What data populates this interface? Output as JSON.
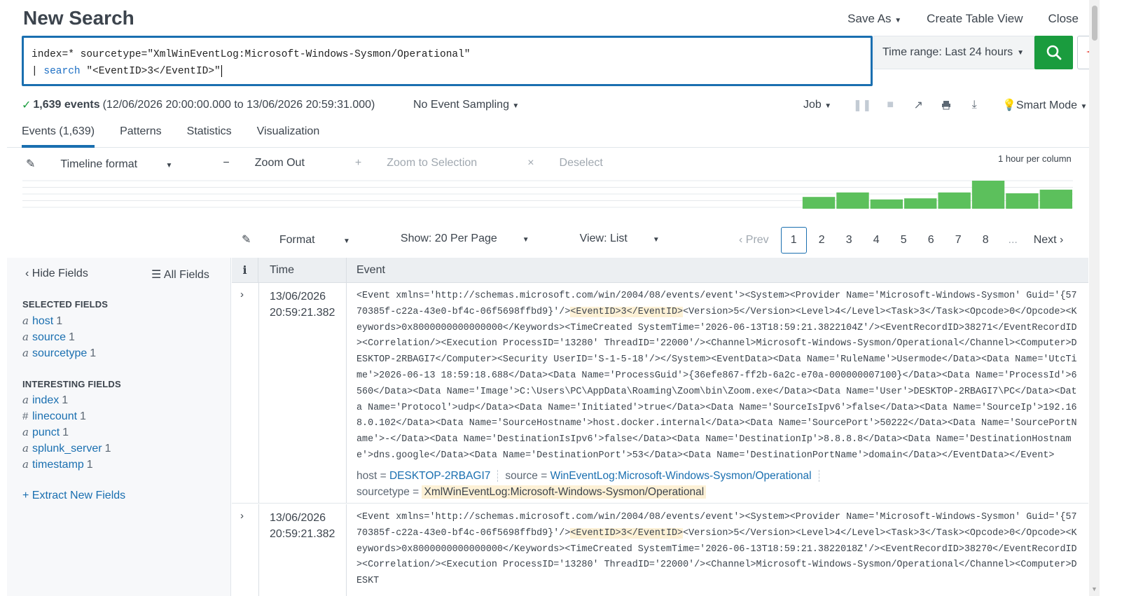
{
  "header": {
    "title": "New Search",
    "actions": [
      "Save As",
      "Create Table View",
      "Close"
    ]
  },
  "search": {
    "line1": "index=* sourcetype=\"XmlWinEventLog:Microsoft-Windows-Sysmon/Operational\"",
    "line2_pipe": "| ",
    "line2_kw": "search",
    "line2_rest": " \"<EventID>3</EventID>\"",
    "time_range": "Time range: Last 24 hours"
  },
  "status": {
    "count": "1,639 events",
    "range": "(12/06/2026 20:00:00.000 to 13/06/2026 20:59:31.000)",
    "sampling": "No Event Sampling",
    "job": "Job",
    "mode": "Smart Mode"
  },
  "tabs": [
    "Events (1,639)",
    "Patterns",
    "Statistics",
    "Visualization"
  ],
  "timeline": {
    "format": "Timeline format",
    "zoom_out": "Zoom Out",
    "zoom_sel": "Zoom to Selection",
    "deselect": "Deselect",
    "per_column": "1 hour per column",
    "bars": [
      0,
      0,
      0,
      0,
      0,
      0,
      0,
      0,
      0,
      0,
      0,
      0,
      0,
      0,
      0,
      0,
      0,
      0,
      0,
      0,
      0,
      0,
      0,
      0.42,
      0.58,
      0.33,
      0.37,
      0.58,
      1.0,
      0.55,
      0.68
    ],
    "bar_color": "#5cc05c"
  },
  "format_row": {
    "format": "Format",
    "show": "Show: 20 Per Page",
    "view": "View: List"
  },
  "pager": {
    "prev": "Prev",
    "pages": [
      "1",
      "2",
      "3",
      "4",
      "5",
      "6",
      "7",
      "8"
    ],
    "ellipsis": "...",
    "next": "Next"
  },
  "sidebar": {
    "hide": "Hide Fields",
    "all": "All Fields",
    "selected_title": "SELECTED FIELDS",
    "selected": [
      {
        "type": "a",
        "name": "host",
        "count": "1"
      },
      {
        "type": "a",
        "name": "source",
        "count": "1"
      },
      {
        "type": "a",
        "name": "sourcetype",
        "count": "1"
      }
    ],
    "interesting_title": "INTERESTING FIELDS",
    "interesting": [
      {
        "type": "a",
        "name": "index",
        "count": "1"
      },
      {
        "type": "#",
        "name": "linecount",
        "count": "1"
      },
      {
        "type": "a",
        "name": "punct",
        "count": "1"
      },
      {
        "type": "a",
        "name": "splunk_server",
        "count": "1"
      },
      {
        "type": "a",
        "name": "timestamp",
        "count": "1"
      }
    ],
    "extract": "+ Extract New Fields"
  },
  "table": {
    "col_i": "i",
    "col_time": "Time",
    "col_event": "Event"
  },
  "events": [
    {
      "date": "13/06/2026",
      "time": "20:59:21.382",
      "pre": "<Event xmlns='http://schemas.microsoft.com/win/2004/08/events/event'><System><Provider Name='Microsoft-Windows-Sysmon' Guid='{5770385f-c22a-43e0-bf4c-06f5698ffbd9}'/>",
      "hit": "<EventID>3</EventID>",
      "post": "<Version>5</Version><Level>4</Level><Task>3</Task><Opcode>0</Opcode><Keywords>0x8000000000000000</Keywords><TimeCreated SystemTime='2026-06-13T18:59:21.3822104Z'/><EventRecordID>38271</EventRecordID><Correlation/><Execution ProcessID='13280' ThreadID='22000'/><Channel>Microsoft-Windows-Sysmon/Operational</Channel><Computer>DESKTOP-2RBAGI7</Computer><Security UserID='S-1-5-18'/></System><EventData><Data Name='RuleName'>Usermode</Data><Data Name='UtcTime'>2026-06-13 18:59:18.688</Data><Data Name='ProcessGuid'>{36efe867-ff2b-6a2c-e70a-000000007100}</Data><Data Name='ProcessId'>6560</Data><Data Name='Image'>C:\\Users\\PC\\AppData\\Roaming\\Zoom\\bin\\Zoom.exe</Data><Data Name='User'>DESKTOP-2RBAGI7\\PC</Data><Data Name='Protocol'>udp</Data><Data Name='Initiated'>true</Data><Data Name='SourceIsIpv6'>false</Data><Data Name='SourceIp'>192.168.0.102</Data><Data Name='SourceHostname'>host.docker.internal</Data><Data Name='SourcePort'>50222</Data><Data Name='SourcePortName'>-</Data><Data Name='DestinationIsIpv6'>false</Data><Data Name='DestinationIp'>8.8.8.8</Data><Data Name='DestinationHostname'>dns.google</Data><Data Name='DestinationPort'>53</Data><Data Name='DestinationPortName'>domain</Data></EventData></Event>",
      "host_k": "host = ",
      "host_v": "DESKTOP-2RBAGI7",
      "source_k": "source = ",
      "source_v": "WinEventLog:Microsoft-Windows-Sysmon/Operational",
      "st_k": "sourcetype = ",
      "st_v": "XmlWinEventLog:Microsoft-Windows-Sysmon/Operational"
    },
    {
      "date": "13/06/2026",
      "time": "20:59:21.382",
      "pre": "<Event xmlns='http://schemas.microsoft.com/win/2004/08/events/event'><System><Provider Name='Microsoft-Windows-Sysmon' Guid='{5770385f-c22a-43e0-bf4c-06f5698ffbd9}'/>",
      "hit": "<EventID>3</EventID>",
      "post": "<Version>5</Version><Level>4</Level><Task>3</Task><Opcode>0</Opcode><Keywords>0x8000000000000000</Keywords><TimeCreated SystemTime='2026-06-13T18:59:21.3822018Z'/><EventRecordID>38270</EventRecordID><Correlation/><Execution ProcessID='13280' ThreadID='22000'/><Channel>Microsoft-Windows-Sysmon/Operational</Channel><Computer>DESKT"
    }
  ]
}
